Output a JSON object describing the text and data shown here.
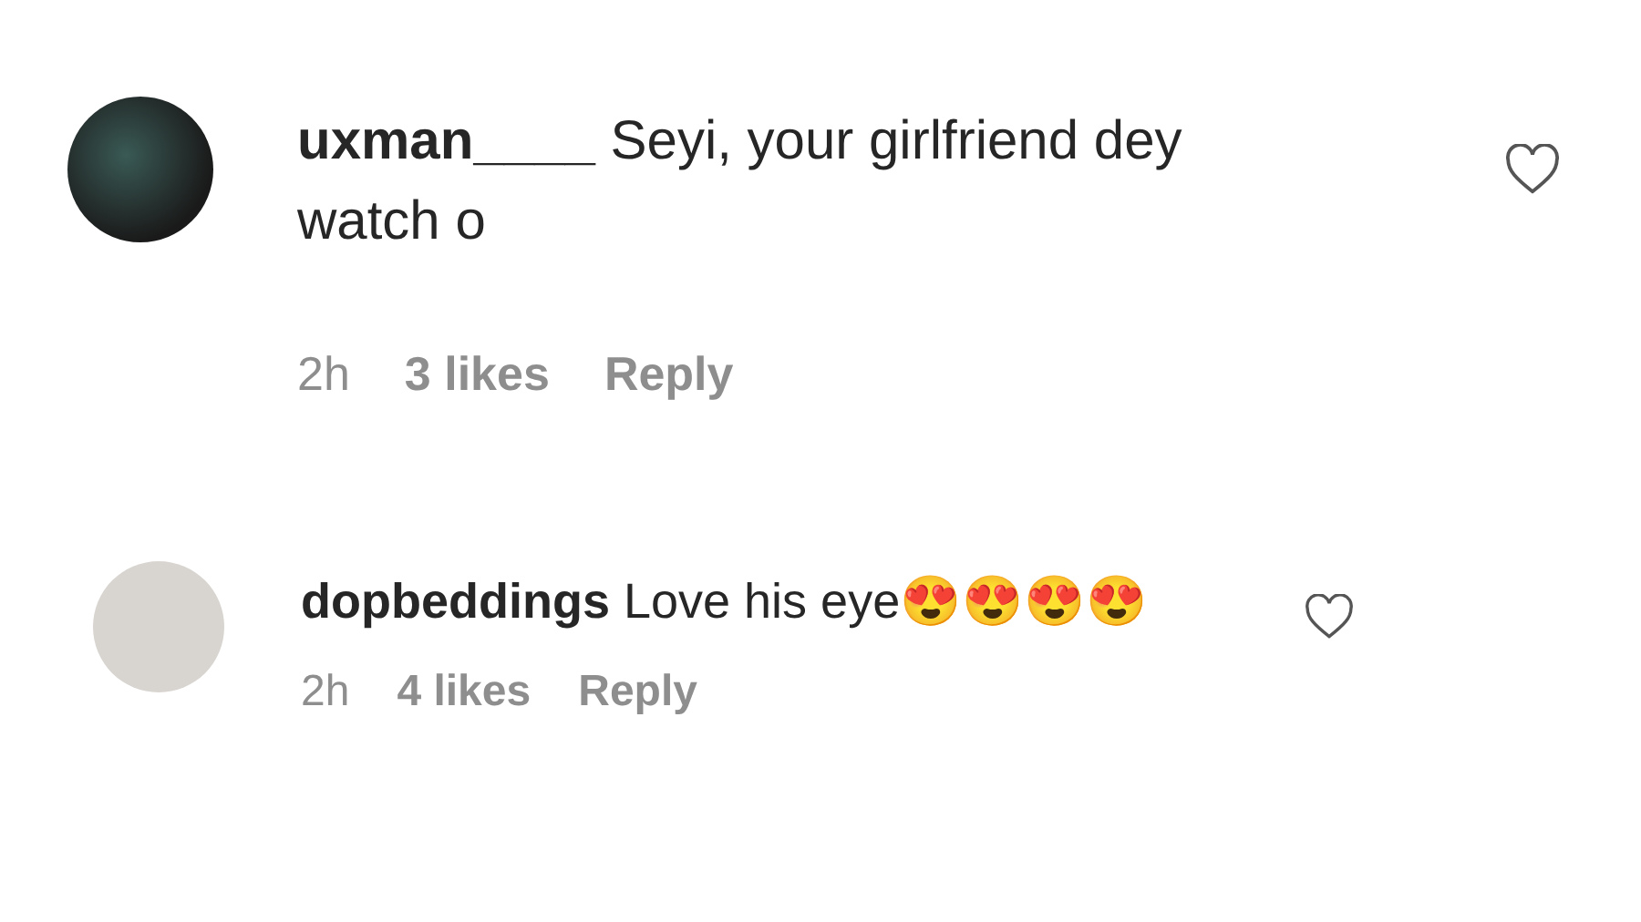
{
  "comments": [
    {
      "username": "uxman____",
      "text": "Seyi, your girlfriend dey watch o",
      "time": "2h",
      "likes": "3 likes",
      "reply": "Reply",
      "liked": false
    },
    {
      "username": "dopbeddings",
      "text": "Love his eye😍😍😍😍",
      "time": "2h",
      "likes": "4 likes",
      "reply": "Reply",
      "liked": false
    }
  ]
}
